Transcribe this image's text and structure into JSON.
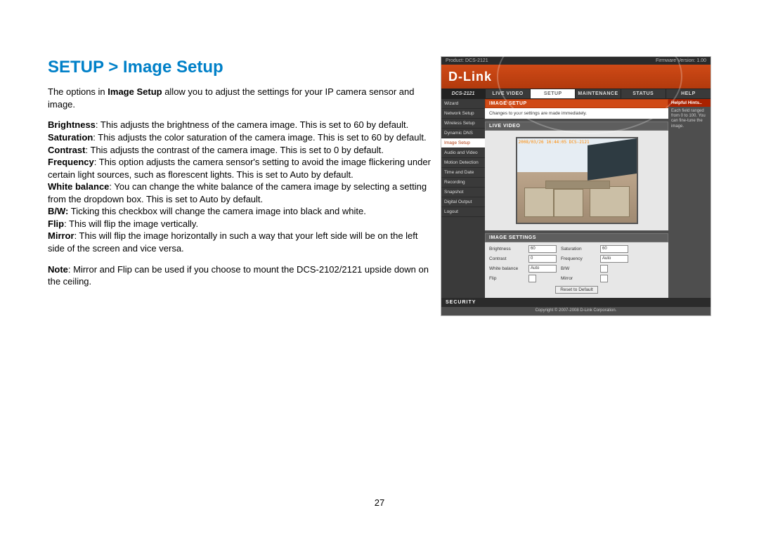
{
  "heading": "SETUP > Image Setup",
  "intro_pre": "The options in ",
  "intro_bold": "Image Setup",
  "intro_post": " allow you to adjust the settings for your IP camera sensor and image.",
  "defs": {
    "brightness_b": "Brightness",
    "brightness_t": ": This adjusts the brightness of the camera image. This is set to 60 by default.",
    "saturation_b": "Saturation",
    "saturation_t": ": This adjusts the color saturation of the camera image. This is set to 60 by default.",
    "contrast_b": "Contrast",
    "contrast_t": ":  This adjusts the contrast of the camera image. This is set to 0 by default.",
    "frequency_b": "Frequency",
    "frequency_t": ": This option adjusts the camera sensor's setting to avoid the image flickering under certain light sources, such as florescent lights. This is set to Auto by default.",
    "wb_b": "White balance",
    "wb_t": ": You can change the white balance of the camera image by selecting a setting from the dropdown box.    This is set to Auto by default.",
    "bw_b": "B/W:",
    "bw_t": " Ticking this checkbox will change the camera image into black and white.",
    "flip_b": "Flip",
    "flip_t": ": This will flip the image vertically.",
    "mirror_b": "Mirror",
    "mirror_t": ": This will flip the image horizontally in such a way that your left side will be on the left side of the screen and vice versa."
  },
  "note_b": "Note",
  "note_t": ": Mirror and Flip can be used if you choose to mount the DCS-2102/2121 upside down on the ceiling.",
  "page_number": "27",
  "shot": {
    "product_label": "Product: DCS-2121",
    "firmware_label": "Firmware  Version: 1.00",
    "brand": "D-Link",
    "model": "DCS-2121",
    "tabs": {
      "live": "LIVE VIDEO",
      "setup": "SETUP",
      "maint": "MAINTENANCE",
      "status": "STATUS",
      "help": "HELP"
    },
    "sidebar": [
      "Wizard",
      "Network Setup",
      "Wireless Setup",
      "Dynamic DNS",
      "Image Setup",
      "Audio and Video",
      "Motion Detection",
      "Time and Date",
      "Recording",
      "Snapshot",
      "Digital Output",
      "Logout"
    ],
    "hints_head": "Helpful Hints..",
    "hints_body": "Each field ranged from 0 to 100. You can fine-tune the image.",
    "img_setup_head": "IMAGE SETUP",
    "img_setup_body": "Changes to your settings are made immediately.",
    "live_head": "LIVE VIDEO",
    "osd": "2008/03/26 16:44:05 DCS-2121",
    "settings_head": "IMAGE SETTINGS",
    "settings": {
      "brightness_l": "Brightness",
      "brightness_v": "60",
      "saturation_l": "Saturation",
      "saturation_v": "60",
      "contrast_l": "Contrast",
      "contrast_v": "0",
      "frequency_l": "Frequency",
      "frequency_v": "Auto",
      "wb_l": "White balance",
      "wb_v": "Auto",
      "bw_l": "B/W",
      "flip_l": "Flip",
      "mirror_l": "Mirror",
      "reset": "Reset to Default"
    },
    "security": "SECURITY",
    "copyright": "Copyright © 2007-2008 D-Link Corporation."
  }
}
